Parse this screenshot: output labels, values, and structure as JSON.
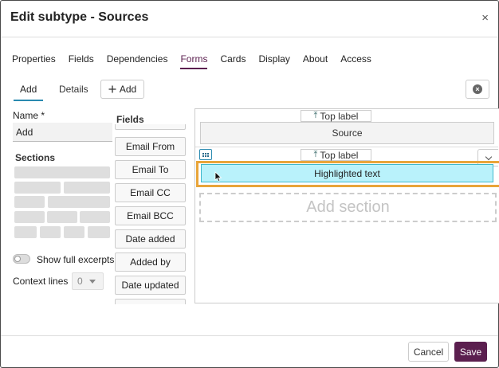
{
  "dialog": {
    "title": "Edit subtype - Sources",
    "close_symbol": "×"
  },
  "tabs": [
    {
      "label": "Properties",
      "active": false
    },
    {
      "label": "Fields",
      "active": false
    },
    {
      "label": "Dependencies",
      "active": false
    },
    {
      "label": "Forms",
      "active": true
    },
    {
      "label": "Cards",
      "active": false
    },
    {
      "label": "Display",
      "active": false
    },
    {
      "label": "About",
      "active": false
    },
    {
      "label": "Access",
      "active": false
    }
  ],
  "form_tabs": {
    "add_label": "Add",
    "details_label": "Details",
    "add_button_label": "Add",
    "add_button_icon": "plus-icon",
    "clear_icon": "clear-circle-icon"
  },
  "left_panel": {
    "name_label": "Name *",
    "name_value": "Add",
    "sections_label": "Sections",
    "show_excerpts_label": "Show full excerpts",
    "show_excerpts_on": false,
    "context_lines_label": "Context lines",
    "context_lines_value": "0"
  },
  "fields_panel": {
    "title": "Fields",
    "items": [
      "Email From",
      "Email To",
      "Email CC",
      "Email BCC",
      "Date added",
      "Added by",
      "Date updated"
    ]
  },
  "canvas": {
    "top_label_1": "Top label",
    "field_1": "Source",
    "top_label_2": "Top label",
    "field_2": "Highlighted text",
    "add_section": "Add section",
    "drag_icon": "drag-grid-icon",
    "chevron_icon": "chevron-down-icon",
    "top_label_icon": "arrow-up-to-line-icon"
  },
  "footer": {
    "cancel_label": "Cancel",
    "save_label": "Save"
  },
  "colors": {
    "accent": "#5b1f4f",
    "tab_underline": "#2a8ab0",
    "highlight_fill": "#b9f2fb",
    "highlight_frame": "#e9a53a"
  }
}
